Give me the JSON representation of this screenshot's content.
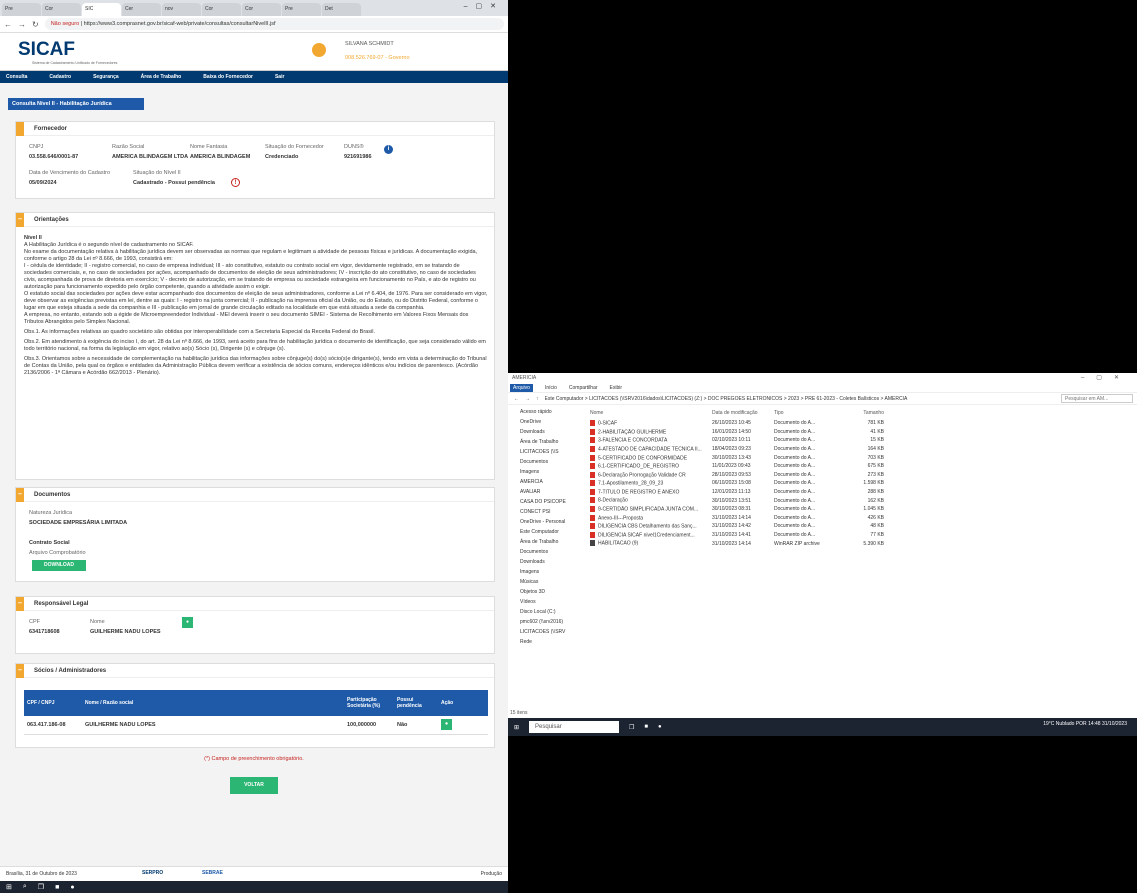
{
  "browser": {
    "tabs": [
      "Pre",
      "Cor",
      "SIC",
      "Cer",
      "nov",
      "Cor",
      "Cor",
      "Pre",
      "Det"
    ],
    "url_warning": "Não seguro",
    "url": "https://www3.comprasnet.gov.br/sicaf-web/private/consultas/consultarNivelII.jsf"
  },
  "site": {
    "logo": "SICAF",
    "logo_sub": "Sistema de Cadastramento Unificado de Fornecedores",
    "user_name": "SILVANA SCHMIDT",
    "user_cpf": "008.526.769-07 - Governo",
    "menu": [
      "Consulta",
      "Cadastro",
      "Segurança",
      "Área de Trabalho",
      "Baixa do Fornecedor",
      "Sair"
    ]
  },
  "page_title": "Consulta Nível II - Habilitação Jurídica",
  "fornecedor": {
    "title": "Fornecedor",
    "cnpj_label": "CNPJ",
    "cnpj": "03.558.646/0001-87",
    "razao_label": "Razão Social",
    "razao": "AMERICA BLINDAGEM LTDA",
    "fantasia_label": "Nome Fantasia",
    "fantasia": "AMERICA BLINDAGEM",
    "situacao_label": "Situação do Fornecedor",
    "situacao": "Credenciado",
    "duns_label": "DUNS®",
    "duns": "921691986",
    "venc_label": "Data de Vencimento do Cadastro",
    "venc": "05/09/2024",
    "nivel_label": "Situação do Nível II",
    "nivel": "Cadastrado - Possui pendência"
  },
  "orientacoes": {
    "title": "Orientações",
    "heading": "Nível II",
    "p1": "A Habilitação Jurídica é o segundo nível de cadastramento no SICAF.",
    "p2": "No exame da documentação relativa à habilitação jurídica devem ser observadas as normas que regulam e legitimam a atividade de pessoas físicas e jurídicas. A documentação exigida, conforme o artigo 28 da Lei nº 8.666, de 1993, consistirá em:",
    "p3": "I - cédula de identidade; II - registro comercial, no caso de empresa individual; III - ato constitutivo, estatuto ou contrato social em vigor, devidamente registrado, em se tratando de sociedades comerciais, e, no caso de sociedades por ações, acompanhado de documentos de eleição de seus administradores; IV - inscrição do ato constitutivo, no caso de sociedades civis, acompanhada de prova de diretoria em exercício; V - decreto de autorização, em se tratando de empresa ou sociedade estrangeira em funcionamento no País, e ato de registro ou autorização para funcionamento expedido pelo órgão competente, quando a atividade assim o exigir.",
    "p4": "O estatuto social das sociedades por ações deve estar acompanhado dos documentos de eleição de seus administradores, conforme a Lei nº 6.404, de 1976. Para ser considerado em vigor, deve observar as exigências previstas em lei, dentre as quais: I - registro na junta comercial; II - publicação na imprensa oficial da União, ou do Estado, ou do Distrito Federal, conforme o lugar em que esteja situada a sede da companhia e III - publicação em jornal de grande circulação editado na localidade em que está situada a sede da companhia.",
    "p5": "A empresa, no entanto, estando sob a égide de Microempreendedor Individual - MEI deverá inserir o seu documento SIMEI - Sistema de Recolhimento em Valores Fixos Mensais dos Tributos Abrangidos pelo Simples Nacional.",
    "obs1": "Obs.1. As informações relativas ao quadro societário são obtidas por interoperabilidade com a Secretaria Especial da Receita Federal do Brasil.",
    "obs2": "Obs.2. Em atendimento à exigência do inciso I, do art. 28 da Lei nº 8.666, de 1993, será aceito para fins de habilitação jurídica o documento de identificação, que seja considerado válido em todo território nacional, na forma da legislação em vigor, relativo ao(s) Sócio (s), Dirigente (s) e cônjuge (s).",
    "obs3": "Obs.3. Orientamos sobre a necessidade de complementação na habilitação jurídica das informações sobre cônjuge(s) do(s) sócio(s)e dirigante(s), tendo em vista a determinação do Tribunal de Contas da União, pela qual os órgãos e entidades da Administração Pública devem verificar a existência de sócios comuns, endereços idênticos e/ou indícios de parentesco. (Acórdão 2136/2006 - 1ª Câmara e Acórdão 662/2013 - Plenário)."
  },
  "documentos": {
    "title": "Documentos",
    "natureza_label": "Natureza Jurídica",
    "natureza": "SOCIEDADE EMPRESÁRIA LIMITADA",
    "contrato_label": "Contrato Social",
    "arquivo_label": "Arquivo Comprobatório",
    "download": "DOWNLOAD"
  },
  "responsavel": {
    "title": "Responsável Legal",
    "cpf_label": "CPF",
    "cpf": "6341718608",
    "nome_label": "Nome",
    "nome": "GUILHERME NADU LOPES"
  },
  "socios": {
    "title": "Sócios / Administradores",
    "headers": [
      "CPF / CNPJ",
      "Nome / Razão social",
      "Participação Societária (%)",
      "Possui pendência",
      "Ação"
    ],
    "row": {
      "cpf": "063.417.186-08",
      "nome": "GUILHERME NADU LOPES",
      "part": "100,000000",
      "pend": "Não"
    }
  },
  "required_note": "(*) Campo de preenchimento obrigatório.",
  "voltar": "VOLTAR",
  "footer": {
    "left": "Brasília, 31 de Outubro de 2023",
    "serpro": "SERPRO",
    "sebrae": "SEBRAE",
    "right": "Produção"
  },
  "explorer": {
    "title": "AMERICIA",
    "ribbon": [
      "Arquivo",
      "Início",
      "Compartilhar",
      "Exibir"
    ],
    "path": "Este Computador  >  LICITACOES (\\\\SRV2016\\dados\\LICITACOES) (Z:)  >  DOC PREGÕES ELETRÔNICOS  >  2023  >  PRE 61-2023 - Coletes Balísticos  >  AMERCIA",
    "search": "Pesquisar em AM...",
    "nav": [
      "Acesso rápido",
      "OneDrive",
      "Downloads",
      "Área de Trabalho",
      "LICITACOES (\\\\S",
      "Documentos",
      "Imagens",
      "AMERCIA",
      "AVALIAR",
      "CASA DO PSICOPE",
      "CONECT PSI",
      "OneDrive - Personal",
      "Este Computador",
      "Área de Trabalho",
      "Documentos",
      "Downloads",
      "Imagens",
      "Músicas",
      "Objetos 3D",
      "Vídeos",
      "Disco Local (C:)",
      "pmc602 (\\\\srv2016)",
      "LICITACOES (\\\\SRV",
      "Rede"
    ],
    "headers": [
      "Nome",
      "Data de modificação",
      "Tipo",
      "Tamanho"
    ],
    "files": [
      {
        "name": "0-SICAF",
        "date": "26/10/2023 10:45",
        "type": "Documento do A...",
        "size": "781 KB"
      },
      {
        "name": "2-HABILITAÇÃO GUILHERME",
        "date": "16/01/2023 14:50",
        "type": "Documento do A...",
        "size": "41 KB"
      },
      {
        "name": "3-FALENCIA E CONCORDATA",
        "date": "02/10/2023 10:11",
        "type": "Documento do A...",
        "size": "15 KB"
      },
      {
        "name": "4-ATESTADO DE CAPACIDADE TÉCNICA II...",
        "date": "18/04/2023 09:23",
        "type": "Documento do A...",
        "size": "164 KB"
      },
      {
        "name": "5-CERTIFICADO DE CONFORMIDADE",
        "date": "30/10/2023 13:43",
        "type": "Documento do A...",
        "size": "703 KB"
      },
      {
        "name": "6.1-CERTIFICADO_DE_REGISTRO",
        "date": "11/01/2023 09:43",
        "type": "Documento do A...",
        "size": "675 KB"
      },
      {
        "name": "6-Declaração Prorrogação Validade CR",
        "date": "28/10/2023 09:53",
        "type": "Documento do A...",
        "size": "273 KB"
      },
      {
        "name": "7.1-Apostilamento_28_09_23",
        "date": "06/10/2023 15:08",
        "type": "Documento do A...",
        "size": "1.598 KB"
      },
      {
        "name": "7-TITULO DE REGISTRO E ANEXO",
        "date": "12/01/2023 11:13",
        "type": "Documento do A...",
        "size": "288 KB"
      },
      {
        "name": "8-Declaração",
        "date": "30/10/2023 13:51",
        "type": "Documento do A...",
        "size": "162 KB"
      },
      {
        "name": "9-CERTIDÃO SIMPLIFICADA JUNTA COM...",
        "date": "30/10/2023 08:31",
        "type": "Documento do A...",
        "size": "1.045 KB"
      },
      {
        "name": "Anexo-III---Proposta",
        "date": "31/10/2023 14:14",
        "type": "Documento do A...",
        "size": "426 KB"
      },
      {
        "name": "DILIGENCIA CBS Detalhamento das Sanç...",
        "date": "31/10/2023 14:42",
        "type": "Documento do A...",
        "size": "48 KB"
      },
      {
        "name": "DILIGENCIA SICAF nivel1Credenciament...",
        "date": "31/10/2023 14:41",
        "type": "Documento do A...",
        "size": "77 KB"
      },
      {
        "name": "HABILITACAO (9)",
        "date": "31/10/2023 14:14",
        "type": "WinRAR ZIP archive",
        "size": "5.390 KB"
      }
    ],
    "status": "15 itens"
  },
  "taskbar": {
    "search": "Pesquisar",
    "weather": "19°C Nublado",
    "lang": "POR",
    "time": "14:48",
    "date": "31/10/2023"
  }
}
